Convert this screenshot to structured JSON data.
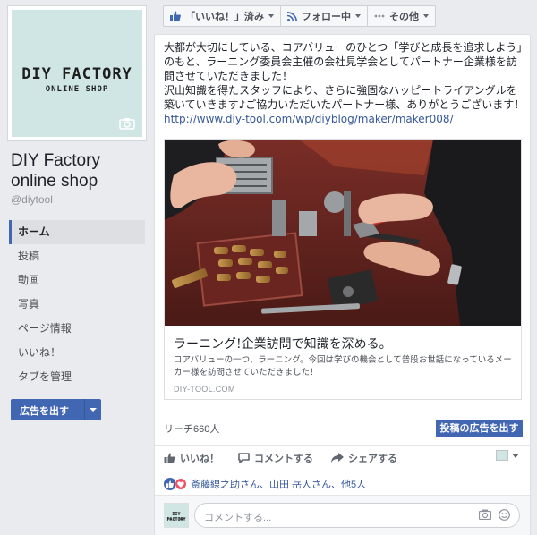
{
  "page": {
    "logo_line1": "DIY FACTORY",
    "logo_line2": "ONLINE SHOP",
    "name": "DIY Factory online shop",
    "handle": "@diytool"
  },
  "nav": {
    "items": [
      {
        "label": "ホーム",
        "active": true
      },
      {
        "label": "投稿"
      },
      {
        "label": "動画"
      },
      {
        "label": "写真"
      },
      {
        "label": "ページ情報"
      },
      {
        "label": "いいね！"
      },
      {
        "label": "タブを管理"
      }
    ],
    "ad_button": "広告を出す"
  },
  "topbar": {
    "liked": "「いいね！」済み",
    "following": "フォロー中",
    "more": "その他"
  },
  "post": {
    "text": "大都が大切にしている、コアバリューのひとつ「学びと成長を追求しよう」のもと、ラーニング委員会主催の会社見学会としてパートナー企業様を訪問させていただきました！\n沢山知識を得たスタッフにより、さらに強固なハッピートライアングルを築いていきます♪ご協力いただいたパートナー様、ありがとうございます！",
    "link": "http://www.diy-tool.com/wp/diyblog/maker/maker008/",
    "link_card": {
      "title": "ラーニング!企業訪問で知識を深める。",
      "description": "コアバリューの一つ、ラーニング。今回は学びの機会として普段お世話になっているメーカー様を訪問させていただきました！",
      "domain": "DIY-TOOL.COM"
    },
    "reach": "リーチ660人",
    "boost_button": "投稿の広告を出す",
    "actions": {
      "like": "いいね！",
      "comment": "コメントする",
      "share": "シェアする"
    },
    "reactions_text": "斎藤線之助さん、山田 岳人さん、他5人",
    "comment_placeholder": "コメントする...",
    "colors": {
      "brand": "#4267b2",
      "link": "#365899",
      "love": "#f25268"
    }
  }
}
